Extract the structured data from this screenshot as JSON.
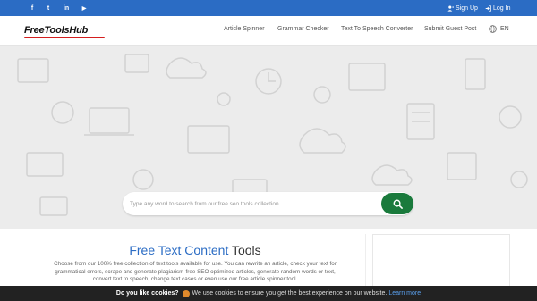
{
  "topbar": {
    "social": [
      {
        "label": "f",
        "icon": "facebook-icon"
      },
      {
        "label": "t",
        "icon": "twitter-icon"
      },
      {
        "label": "in",
        "icon": "linkedin-icon"
      },
      {
        "label": "▶",
        "icon": "youtube-icon"
      }
    ],
    "signup_label": "Sign Up",
    "login_label": "Log In"
  },
  "navbar": {
    "logo_text": "FreeToolsHub",
    "links": [
      "Article Spinner",
      "Grammar Checker",
      "Text To Speech Converter",
      "Submit Guest Post"
    ],
    "language": "EN"
  },
  "search": {
    "placeholder": "Type any word to search from our free seo tools collection"
  },
  "main": {
    "title_colored": "Free Text Content",
    "title_plain": "Tools",
    "description": "Choose from our 100% free collection of text tools available for use. You can rewrite an article, check your text for grammatical errors, scrape and generate plagiarism-free SEO optimized articles, generate random words or text, convert text to speech, change text cases or even use our free article spinner tool."
  },
  "cookie": {
    "question": "Do you like cookies?",
    "message": "We use cookies to ensure you get the best experience on our website.",
    "learn_more": "Learn more"
  },
  "colors": {
    "topbar": "#2b6cc4",
    "search_button": "#1a7a3c",
    "title_accent": "#2b6cc4"
  }
}
